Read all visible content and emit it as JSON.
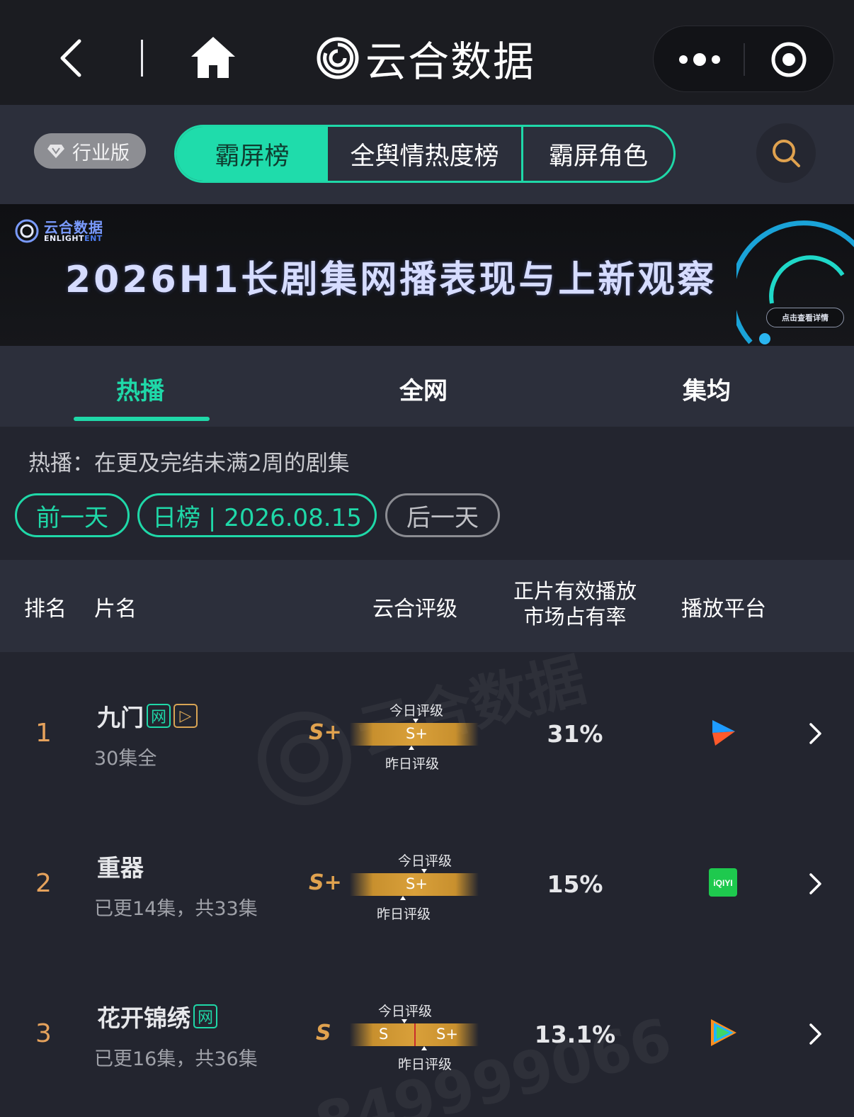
{
  "nav": {
    "title": "云合数据"
  },
  "topbar": {
    "edition_label": "行业版",
    "tabs": [
      "霸屏榜",
      "全舆情热度榜",
      "霸屏角色"
    ]
  },
  "banner": {
    "logo_cn": "云合数据",
    "logo_en_a": "ENLIGHT",
    "logo_en_b": "ENT",
    "title": "2026H1长剧集网播表现与上新观察",
    "button": "点击查看详情"
  },
  "category_tabs": [
    "热播",
    "全网",
    "集均"
  ],
  "description": "热播：在更及完结未满2周的剧集",
  "date_nav": {
    "prev": "前一天",
    "current": "日榜 | 2026.08.15",
    "next": "后一天"
  },
  "table": {
    "headers": {
      "rank": "排名",
      "name": "片名",
      "rating": "云合评级",
      "share_line1": "正片有效播放",
      "share_line2": "市场占有率",
      "platform": "播放平台"
    },
    "today_label": "今日评级",
    "yesterday_label": "昨日评级",
    "rows": [
      {
        "rank": "1",
        "title": "九门",
        "tags": [
          "网",
          "▷"
        ],
        "status": "30集全",
        "rating": "S+",
        "today": "S+",
        "yesterday": "S+",
        "share": "31%",
        "platform": "youku-icon"
      },
      {
        "rank": "2",
        "title": "重器",
        "tags": [],
        "status": "已更14集，共33集",
        "rating": "S+",
        "today": "S+",
        "yesterday": "S+",
        "share": "15%",
        "platform": "iqiyi-icon",
        "platform_text": "iQIYI"
      },
      {
        "rank": "3",
        "title": "花开锦绣",
        "tags": [
          "网"
        ],
        "status": "已更16集，共36集",
        "rating": "S",
        "today": "S",
        "yesterday": "S+",
        "share": "13.1%",
        "platform": "tencent-video-icon"
      }
    ]
  },
  "watermark": "云合数据",
  "watermark_bottom": "849999066",
  "colors": {
    "accent": "#1fd8a8",
    "rank": "#e5a25c",
    "rating": "#e0a24f",
    "bg": "#23252f"
  }
}
